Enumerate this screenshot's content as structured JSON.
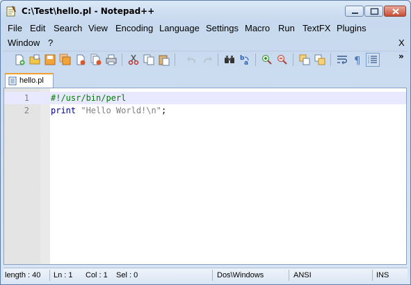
{
  "window": {
    "title": "C:\\Test\\hello.pl - Notepad++"
  },
  "menubar": {
    "items": [
      {
        "label": "File",
        "name": "menu-file"
      },
      {
        "label": "Edit",
        "name": "menu-edit"
      },
      {
        "label": "Search",
        "name": "menu-search"
      },
      {
        "label": "View",
        "name": "menu-view"
      },
      {
        "label": "Encoding",
        "name": "menu-encoding"
      },
      {
        "label": "Language",
        "name": "menu-language"
      },
      {
        "label": "Settings",
        "name": "menu-settings"
      },
      {
        "label": "Macro",
        "name": "menu-macro"
      },
      {
        "label": "Run",
        "name": "menu-run"
      },
      {
        "label": "TextFX",
        "name": "menu-textfx"
      },
      {
        "label": "Plugins",
        "name": "menu-plugins"
      },
      {
        "label": "Window",
        "name": "menu-window"
      },
      {
        "label": "?",
        "name": "menu-help"
      }
    ],
    "close_label": "X"
  },
  "toolbar": {
    "overflow_label": "»",
    "buttons": [
      "new-file-icon",
      "open-file-icon",
      "save-icon",
      "save-all-icon",
      "close-icon",
      "close-all-icon",
      "print-icon",
      "cut-icon",
      "copy-icon",
      "paste-icon",
      "undo-icon",
      "redo-icon",
      "find-icon",
      "replace-icon",
      "zoom-in-icon",
      "zoom-out-icon",
      "sync-vertical-icon",
      "sync-horizontal-icon",
      "word-wrap-icon",
      "show-all-characters-icon",
      "indent-guide-icon"
    ]
  },
  "tabs": [
    {
      "label": "hello.pl",
      "active": true
    }
  ],
  "editor": {
    "lines": [
      {
        "number": "1",
        "tokens": [
          {
            "text": "#!/usr/bin/perl",
            "type": "comment"
          }
        ],
        "current": true
      },
      {
        "number": "2",
        "tokens": [
          {
            "text": "print",
            "type": "keyword"
          },
          {
            "text": " ",
            "type": "plain"
          },
          {
            "text": "\"Hello World!\\n\"",
            "type": "string"
          },
          {
            "text": ";",
            "type": "plain"
          }
        ],
        "current": false
      }
    ]
  },
  "statusbar": {
    "length": "length : 40",
    "line": "Ln : 1",
    "col": "Col : 1",
    "sel": "Sel : 0",
    "eol": "Dos\\Windows",
    "encoding": "ANSI",
    "mode": "INS"
  },
  "colors": {
    "comment": "#008000",
    "keyword": "#00008b",
    "string": "#808080",
    "current_line": "#e8e8ff",
    "tab_accent": "#f0a030"
  }
}
